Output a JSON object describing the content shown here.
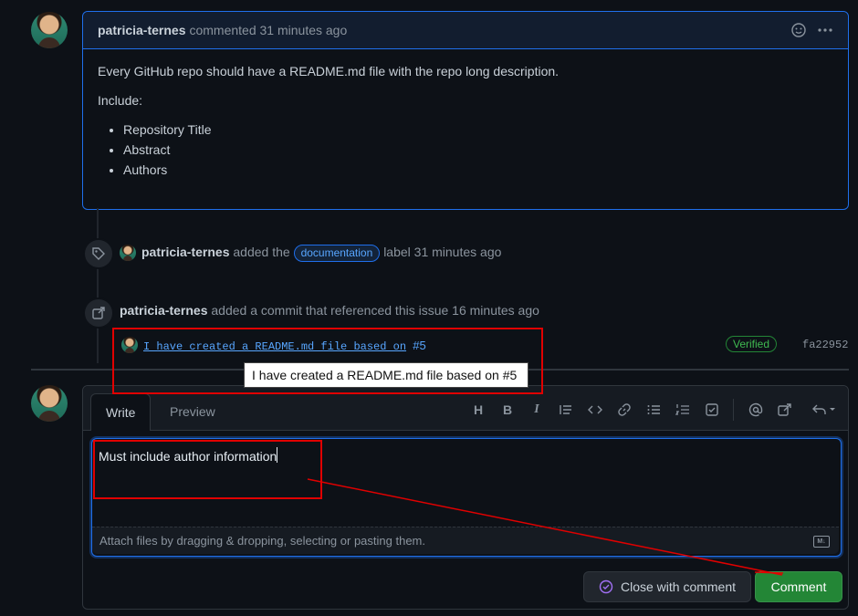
{
  "comment": {
    "author": "patricia-ternes",
    "meta": "commented 31 minutes ago",
    "paragraph": "Every GitHub repo should have a README.md file with the repo long description.",
    "include_label": "Include:",
    "items": [
      "Repository Title",
      "Abstract",
      "Authors"
    ]
  },
  "label_event": {
    "author": "patricia-ternes",
    "pre": "added the",
    "label": "documentation",
    "post": "label 31 minutes ago",
    "label_color": "#58a6ff"
  },
  "commit_event": {
    "author": "patricia-ternes",
    "text": "added a commit that referenced this issue 16 minutes ago",
    "commit_message": "I have created a README.md file based on",
    "commit_ref": "#5",
    "verified": "Verified",
    "sha": "fa22952"
  },
  "tooltip": "I have created a README.md file based on #5",
  "editor": {
    "tabs": [
      "Write",
      "Preview"
    ],
    "value": "Must include author information",
    "attach_text": "Attach files by dragging & dropping, selecting or pasting them.",
    "close_button": "Close with comment",
    "comment_button": "Comment"
  },
  "colors": {
    "accent": "#1f6feb",
    "primary_button": "#238636",
    "annotation": "#e00000"
  }
}
